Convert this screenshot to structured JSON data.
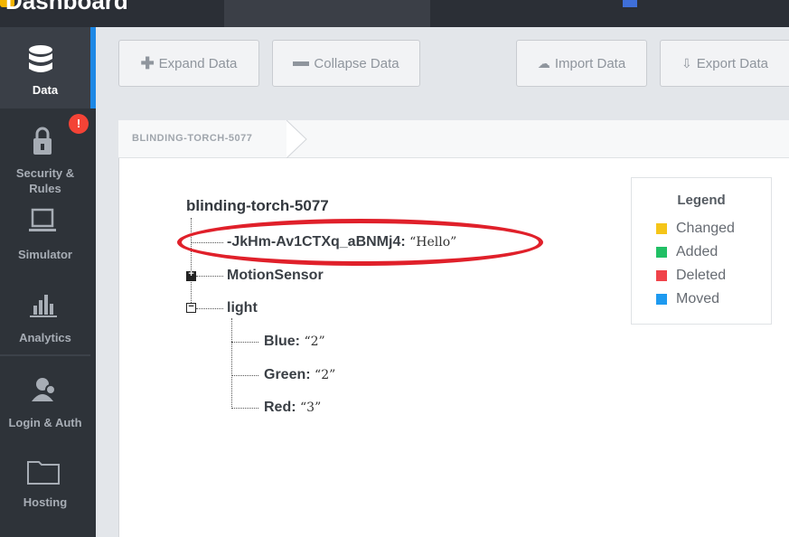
{
  "window": {
    "title": "Dashboard"
  },
  "sidebar": {
    "items": [
      {
        "label": "Data",
        "icon": "database-icon"
      },
      {
        "label_line1": "Security &",
        "label_line2": "Rules",
        "icon": "lock-icon",
        "badge": "!"
      },
      {
        "label": "Simulator",
        "icon": "monitor-icon"
      },
      {
        "label": "Analytics",
        "icon": "bar-chart-icon"
      },
      {
        "label": "Login & Auth",
        "icon": "user-icon"
      },
      {
        "label": "Hosting",
        "icon": "folder-icon"
      }
    ]
  },
  "toolbar": {
    "expand_label": "Expand Data",
    "collapse_label": "Collapse Data",
    "import_label": "Import Data",
    "export_label": "Export Data"
  },
  "breadcrumb": {
    "label": "BLINDING-TORCH-5077"
  },
  "tree": {
    "root": "blinding-torch-5077",
    "push_key": "-JkHm-Av1CTXq_aBNMj4:",
    "push_value": "“Hello”",
    "motion_key": "MotionSensor",
    "light_key": "light",
    "children": [
      {
        "key": "Blue:",
        "value": "“2”"
      },
      {
        "key": "Green:",
        "value": "“2”"
      },
      {
        "key": "Red:",
        "value": "“3”"
      }
    ]
  },
  "legend": {
    "title": "Legend",
    "items": [
      {
        "label": "Changed",
        "color": "#f5c518"
      },
      {
        "label": "Added",
        "color": "#21c065"
      },
      {
        "label": "Deleted",
        "color": "#f0434a"
      },
      {
        "label": "Moved",
        "color": "#1e9af0"
      }
    ]
  },
  "colors": {
    "sidebar_bg": "#2e3339",
    "accent": "#1e88e5",
    "highlight": "#e0202a"
  }
}
